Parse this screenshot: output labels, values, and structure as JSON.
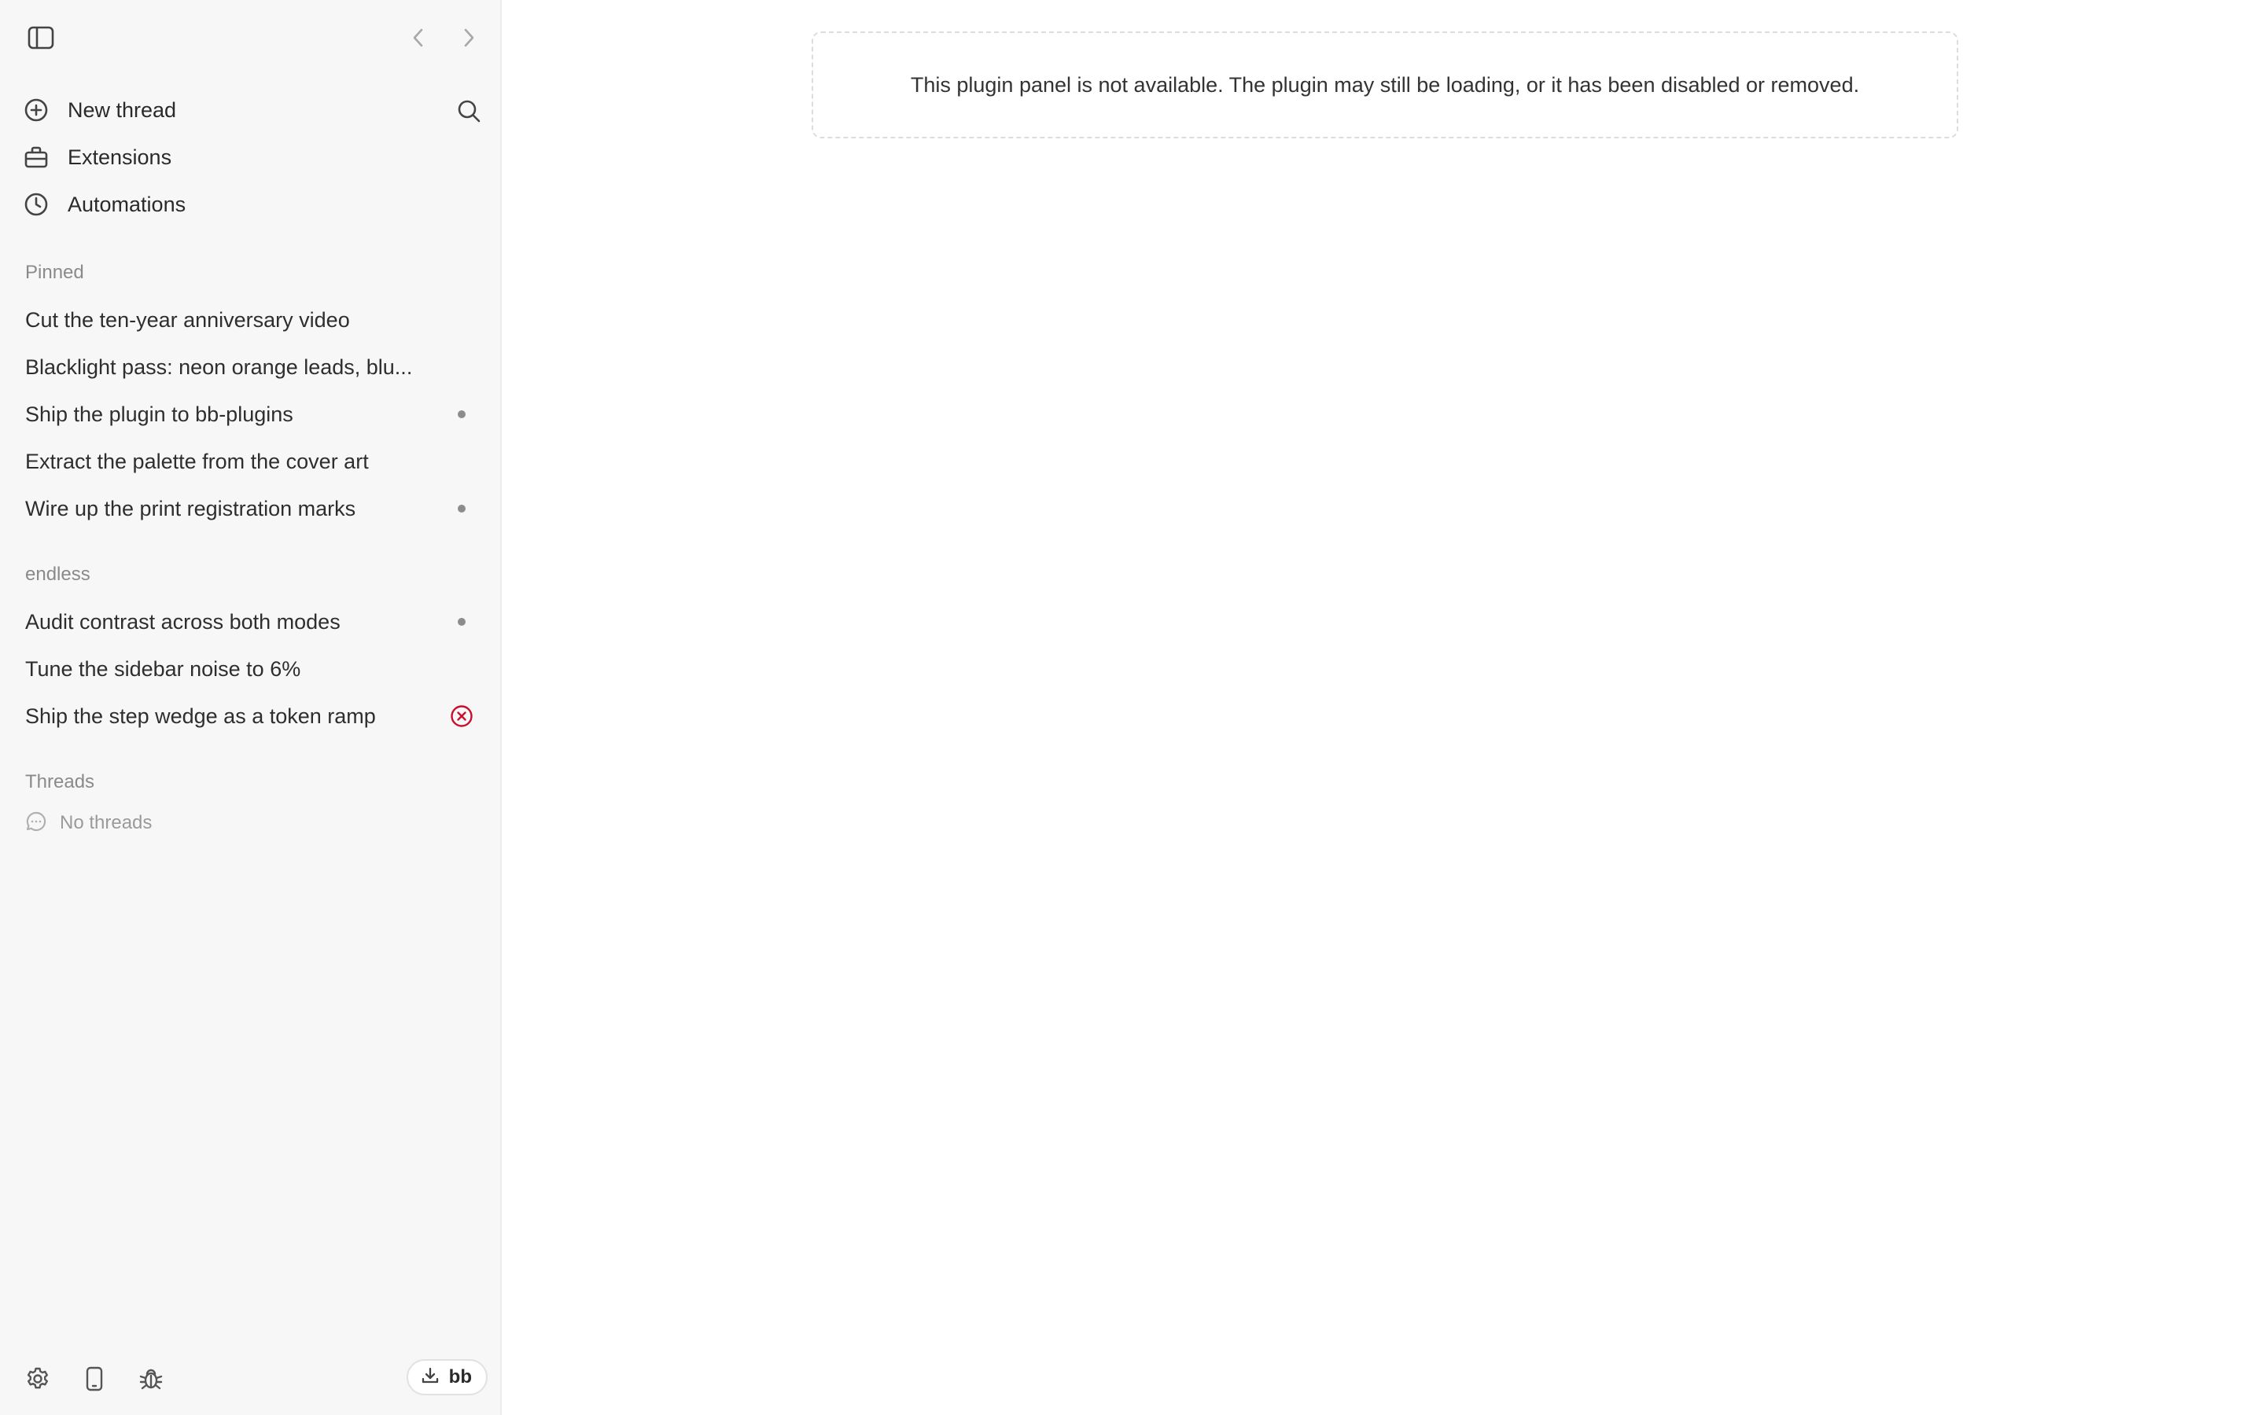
{
  "sidebar": {
    "nav": [
      {
        "label": "New thread",
        "icon": "plus-circle-icon"
      },
      {
        "label": "Extensions",
        "icon": "toolbox-icon"
      },
      {
        "label": "Automations",
        "icon": "clock-icon"
      }
    ],
    "sections": [
      {
        "title": "Pinned",
        "items": [
          {
            "label": "Cut the ten-year anniversary video",
            "status": "none"
          },
          {
            "label": "Blacklight pass: neon orange leads, blu...",
            "status": "none"
          },
          {
            "label": "Ship the plugin to bb-plugins",
            "status": "dot"
          },
          {
            "label": "Extract the palette from the cover art",
            "status": "none"
          },
          {
            "label": "Wire up the print registration marks",
            "status": "dot"
          }
        ]
      },
      {
        "title": "endless",
        "items": [
          {
            "label": "Audit contrast across both modes",
            "status": "dot"
          },
          {
            "label": "Tune the sidebar noise to 6%",
            "status": "none"
          },
          {
            "label": "Ship the step wedge as a token ramp",
            "status": "error"
          }
        ]
      },
      {
        "title": "Threads",
        "empty_label": "No threads"
      }
    ],
    "bottom": {
      "pill_label": "bb"
    }
  },
  "main": {
    "notice": "This plugin panel is not available. The plugin may still be loading, or it has been disabled or removed."
  },
  "colors": {
    "sidebar_bg": "#f7f7f7",
    "error_red": "#c8102e",
    "dot_gray": "#8c8c8c"
  }
}
